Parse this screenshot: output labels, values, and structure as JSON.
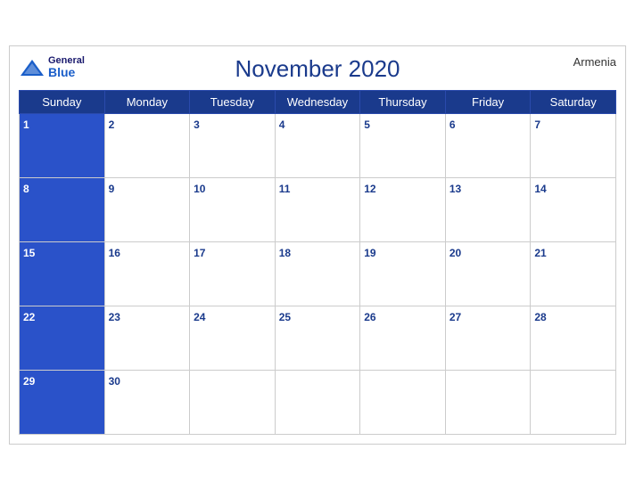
{
  "header": {
    "logo": {
      "general": "General",
      "blue": "Blue",
      "icon_color": "#1a5ec9"
    },
    "title": "November 2020",
    "country": "Armenia"
  },
  "days_of_week": [
    "Sunday",
    "Monday",
    "Tuesday",
    "Wednesday",
    "Thursday",
    "Friday",
    "Saturday"
  ],
  "weeks": [
    {
      "dates": [
        1,
        2,
        3,
        4,
        5,
        6,
        7
      ]
    },
    {
      "dates": [
        8,
        9,
        10,
        11,
        12,
        13,
        14
      ]
    },
    {
      "dates": [
        15,
        16,
        17,
        18,
        19,
        20,
        21
      ]
    },
    {
      "dates": [
        22,
        23,
        24,
        25,
        26,
        27,
        28
      ]
    },
    {
      "dates": [
        29,
        30,
        null,
        null,
        null,
        null,
        null
      ]
    }
  ],
  "colors": {
    "header_bg": "#1a3a8c",
    "row_header_bg": "#2a52c9",
    "cell_bg": "#ffffff",
    "border": "#cccccc",
    "date_text_blue": "#1a3a8c",
    "date_text_white": "#ffffff"
  }
}
